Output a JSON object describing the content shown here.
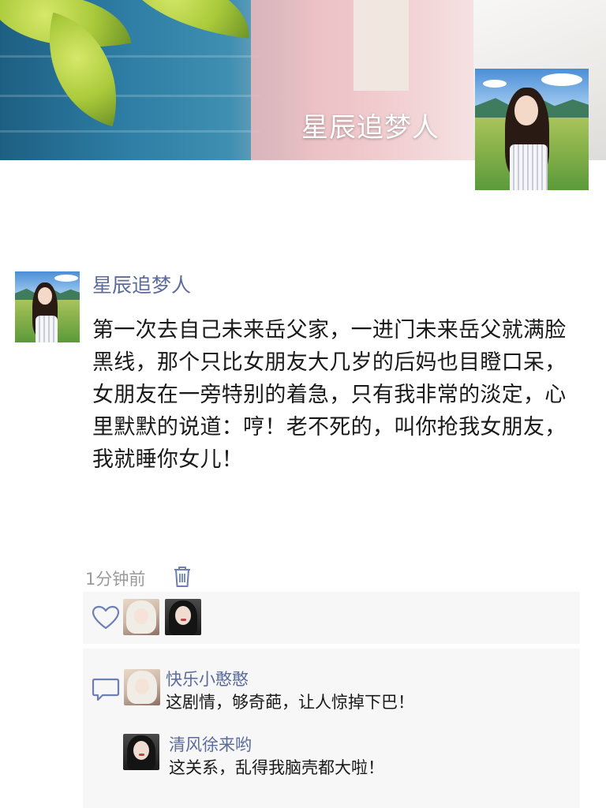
{
  "cover": {
    "title": "星辰追梦人"
  },
  "post": {
    "author": "星辰追梦人",
    "text": "第一次去自己未来岳父家，一进门未来岳父就满脸黑线，那个只比女朋友大几岁的后妈也目瞪口呆，女朋友在一旁特别的着急，只有我非常的淡定，心里默默的说道：哼！老不死的，叫你抢我女朋友，我就睡你女儿！",
    "time": "1分钟前"
  },
  "likes": {
    "icon": "heart-icon",
    "users": [
      "anime-avatar",
      "dark-hair-avatar"
    ]
  },
  "comments": [
    {
      "name": "快乐小憨憨",
      "text": "这剧情，够奇葩，让人惊掉下巴！"
    },
    {
      "name": "清风徐来哟",
      "text": "这关系，乱得我脑壳都大啦！"
    }
  ],
  "colors": {
    "link": "#5b6b9a",
    "icon": "#6d7fb5",
    "panel": "#f7f7f7",
    "time": "#9a9a9a"
  }
}
